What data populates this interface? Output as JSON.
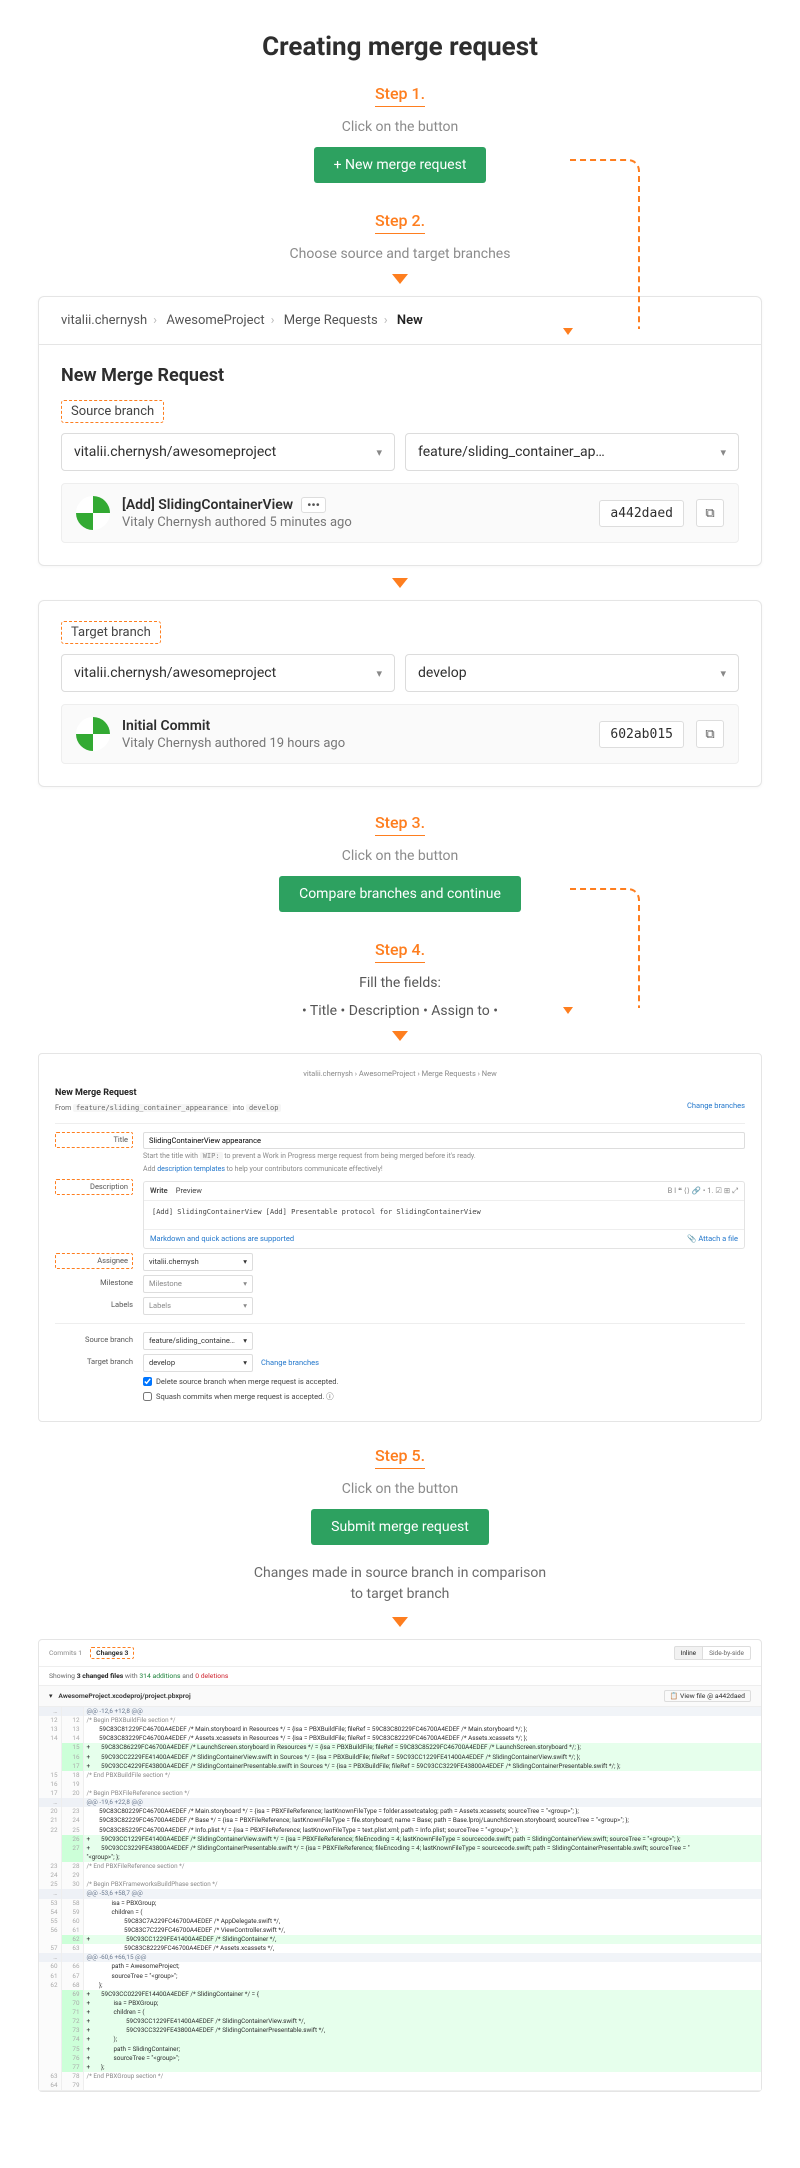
{
  "title": "Creating merge request",
  "step1": {
    "label": "Step 1.",
    "sub": "Click on the button",
    "button": "+ New merge request"
  },
  "step2": {
    "label": "Step 2.",
    "sub": "Choose source and target branches"
  },
  "breadcrumbs": {
    "a": "vitalii.chernysh",
    "b": "AwesomeProject",
    "c": "Merge Requests",
    "d": "New"
  },
  "new_mr_title": "New Merge Request",
  "source": {
    "label": "Source branch",
    "project": "vitalii.chernysh/awesomeproject",
    "branch": "feature/sliding_container_ap…",
    "commit_title": "[Add] SlidingContainerView",
    "author": "Vitaly Chernysh",
    "when": " authored 5 minutes ago",
    "hash": "a442daed"
  },
  "target": {
    "label": "Target branch",
    "project": "vitalii.chernysh/awesomeproject",
    "branch": "develop",
    "commit_title": "Initial Commit",
    "author": "Vitaly Chernysh",
    "when": " authored 19 hours ago",
    "hash": "602ab015"
  },
  "step3": {
    "label": "Step 3.",
    "sub": "Click on the button",
    "button": "Compare branches and continue"
  },
  "step4": {
    "label": "Step 4.",
    "sub": "Fill the fields:",
    "bullets": "• Title • Description • Assign to •",
    "crumb": "vitalii.chernysh  ›  AwesomeProject  ›  Merge Requests  ›  New",
    "h3": "New Merge Request",
    "from_a": "feature/sliding_container_appearance",
    "from_mid": " into ",
    "from_b": "develop",
    "change_branches": "Change branches",
    "labels": {
      "title": "Title",
      "desc": "Description",
      "assignee": "Assignee",
      "milestone": "Milestone",
      "labelsL": "Labels",
      "src": "Source branch",
      "tgt": "Target branch"
    },
    "title_val": "SlidingContainerView appearance",
    "title_hint_a": "Start the title with ",
    "title_hint_code": "WIP:",
    "title_hint_b": " to prevent a Work in Progress merge request from being merged before it's ready.",
    "title_hint2a": "Add ",
    "title_hint2link": "description templates",
    "title_hint2b": " to help your contributors communicate effectively!",
    "tabs": {
      "write": "Write",
      "preview": "Preview"
    },
    "desc_body": "[Add] SlidingContainerView\n[Add] Presentable protocol for SlidingContainerView",
    "ed_foot_left": "Markdown and quick actions are supported",
    "ed_foot_right": "📎 Attach a file",
    "assignee_val": "vitalii.chernysh",
    "milestone_val": "Milestone",
    "labels_val": "Labels",
    "src_val": "feature/sliding_containe…",
    "tgt_val": "develop",
    "change2": "Change branches",
    "cb1": "Delete source branch when merge request is accepted.",
    "cb2": "Squash commits when merge request is accepted. ⓘ"
  },
  "step5": {
    "label": "Step 5.",
    "sub": "Click on the button",
    "button": "Submit merge request"
  },
  "diff_intro": "Changes made in source branch in comparison\nto target branch",
  "diff": {
    "tab_commits": "Commits  1",
    "tab_changes": "Changes  3",
    "inline": "Inline",
    "sbs": "Side-by-side",
    "summary_a": "Showing ",
    "summary_files": "3 changed files",
    "summary_b": " with ",
    "summary_adds": "314 additions",
    "summary_c": " and ",
    "summary_dels": "0 deletions",
    "file1": "AwesomeProject.xcodeproj/project.pbxproj",
    "fh_sha": "📋   View file @ a442daed",
    "toolbars": "B  I  ❝  ⟨⟩  🔗  •  1.  ☑  ⊞  ⤢"
  },
  "code1": [
    {
      "t": "hunk",
      "l1": "…",
      "l2": "",
      "c": "@@ -12,6 +12,8 @@"
    },
    {
      "t": "cmt",
      "l1": "12",
      "l2": "12",
      "c": "/* Begin PBXBuildFile section */"
    },
    {
      "t": "ctx",
      "l1": "13",
      "l2": "13",
      "c": "        59C83C81229FC46700A4EDEF /* Main.storyboard in Resources */ = {isa = PBXBuildFile; fileRef = 59C83C80229FC46700A4EDEF /* Main.storyboard */; };"
    },
    {
      "t": "ctx",
      "l1": "14",
      "l2": "14",
      "c": "        59C83C83229FC46700A4EDEF /* Assets.xcassets in Resources */ = {isa = PBXBuildFile; fileRef = 59C83C82229FC46700A4EDEF /* Assets.xcassets */; };"
    },
    {
      "t": "add",
      "l1": "",
      "l2": "15",
      "c": "+       59C83C86229FC46700A4EDEF /* LaunchScreen.storyboard in Resources */ = {isa = PBXBuildFile; fileRef = 59C83C85229FC46700A4EDEF /* LaunchScreen.storyboard */; };"
    },
    {
      "t": "add",
      "l1": "",
      "l2": "16",
      "c": "+       59C93CC2229FE41400A4EDEF /* SlidingContainerView.swift in Sources */ = {isa = PBXBuildFile; fileRef = 59C93CC1229FE41400A4EDEF /* SlidingContainerView.swift */; };"
    },
    {
      "t": "add",
      "l1": "",
      "l2": "17",
      "c": "+       59C93CC4229FE43800A4EDEF /* SlidingContainerPresentable.swift in Sources */ = {isa = PBXBuildFile; fileRef = 59C93CC3229FE43800A4EDEF /* SlidingContainerPresentable.swift */; };"
    },
    {
      "t": "cmt",
      "l1": "15",
      "l2": "18",
      "c": "/* End PBXBuildFile section */"
    },
    {
      "t": "ctx",
      "l1": "16",
      "l2": "19",
      "c": ""
    },
    {
      "t": "cmt",
      "l1": "17",
      "l2": "20",
      "c": "/* Begin PBXFileReference section */"
    },
    {
      "t": "hunk",
      "l1": "…",
      "l2": "",
      "c": "@@ -19,6 +22,8 @@"
    },
    {
      "t": "ctx",
      "l1": "20",
      "l2": "23",
      "c": "        59C83C80229FC46700A4EDEF /* Main.storyboard */ = {isa = PBXFileReference; lastKnownFileType = folder.assetcatalog; path = Assets.xcassets; sourceTree = \"<group>\"; };"
    },
    {
      "t": "ctx",
      "l1": "21",
      "l2": "24",
      "c": "        59C83C82229FC46700A4EDEF /* Base */ = {isa = PBXFileReference; lastKnownFileType = file.storyboard; name = Base; path = Base.lproj/LaunchScreen.storyboard; sourceTree = \"<group>\"; };"
    },
    {
      "t": "ctx",
      "l1": "22",
      "l2": "25",
      "c": "        59C83C85229FC46700A4EDEF /* Info.plist */ = {isa = PBXFileReference; lastKnownFileType = text.plist.xml; path = Info.plist; sourceTree = \"<group>\"; };"
    },
    {
      "t": "add",
      "l1": "",
      "l2": "26",
      "c": "+       59C93CC1229FE41400A4EDEF /* SlidingContainerView.swift */ = {isa = PBXFileReference; fileEncoding = 4; lastKnownFileType = sourcecode.swift; path = SlidingContainerView.swift; sourceTree = \"<group>\"; };"
    },
    {
      "t": "add",
      "l1": "",
      "l2": "27",
      "c": "+       59C93CC3229FE43800A4EDEF /* SlidingContainerPresentable.swift */ = {isa = PBXFileReference; fileEncoding = 4; lastKnownFileType = sourcecode.swift; path = SlidingContainerPresentable.swift; sourceTree = \""
    },
    {
      "t": "add",
      "l1": "",
      "l2": "",
      "c": "\"<group>\"; };"
    },
    {
      "t": "cmt",
      "l1": "23",
      "l2": "28",
      "c": "/* End PBXFileReference section */"
    },
    {
      "t": "ctx",
      "l1": "24",
      "l2": "29",
      "c": ""
    },
    {
      "t": "cmt",
      "l1": "25",
      "l2": "30",
      "c": "/* Begin PBXFrameworksBuildPhase section */"
    },
    {
      "t": "hunk",
      "l1": "…",
      "l2": "",
      "c": "@@ -53,6 +58,7 @@"
    },
    {
      "t": "ctx",
      "l1": "53",
      "l2": "58",
      "c": "                isa = PBXGroup;"
    },
    {
      "t": "ctx",
      "l1": "54",
      "l2": "59",
      "c": "                children = ("
    },
    {
      "t": "ctx",
      "l1": "55",
      "l2": "60",
      "c": "                        59C83C7A229FC46700A4EDEF /* AppDelegate.swift */,"
    },
    {
      "t": "ctx",
      "l1": "56",
      "l2": "61",
      "c": "                        59C83C7C229FC46700A4EDEF /* ViewController.swift */,"
    },
    {
      "t": "add",
      "l1": "",
      "l2": "62",
      "c": "+                       59C93CC1229FE41400A4EDEF /* SlidingContainer */,"
    },
    {
      "t": "ctx",
      "l1": "57",
      "l2": "63",
      "c": "                        59C83C82229FC46700A4EDEF /* Assets.xcassets */,"
    },
    {
      "t": "hunk",
      "l1": "…",
      "l2": "",
      "c": "@@ -60,6 +66,15 @@"
    },
    {
      "t": "ctx",
      "l1": "60",
      "l2": "66",
      "c": "                path = AwesomeProject;"
    },
    {
      "t": "ctx",
      "l1": "61",
      "l2": "67",
      "c": "                sourceTree = \"<group>\";"
    },
    {
      "t": "ctx",
      "l1": "62",
      "l2": "68",
      "c": "        };"
    },
    {
      "t": "add",
      "l1": "",
      "l2": "69",
      "c": "+       59C93CC0229FE14400A4EDEF /* SlidingContainer */ = {"
    },
    {
      "t": "add",
      "l1": "",
      "l2": "70",
      "c": "+               isa = PBXGroup;"
    },
    {
      "t": "add",
      "l1": "",
      "l2": "71",
      "c": "+               children = ("
    },
    {
      "t": "add",
      "l1": "",
      "l2": "72",
      "c": "+                       59C93CC1229FE41400A4EDEF /* SlidingContainerView.swift */,"
    },
    {
      "t": "add",
      "l1": "",
      "l2": "73",
      "c": "+                       59C93CC3229FE43800A4EDEF /* SlidingContainerPresentable.swift */,"
    },
    {
      "t": "add",
      "l1": "",
      "l2": "74",
      "c": "+               );"
    },
    {
      "t": "add",
      "l1": "",
      "l2": "75",
      "c": "+               path = SlidingContainer;"
    },
    {
      "t": "add",
      "l1": "",
      "l2": "76",
      "c": "+               sourceTree = \"<group>\";"
    },
    {
      "t": "add",
      "l1": "",
      "l2": "77",
      "c": "+       };"
    },
    {
      "t": "cmt",
      "l1": "63",
      "l2": "78",
      "c": "/* End PBXGroup section */"
    },
    {
      "t": "ctx",
      "l1": "64",
      "l2": "79",
      "c": ""
    }
  ]
}
